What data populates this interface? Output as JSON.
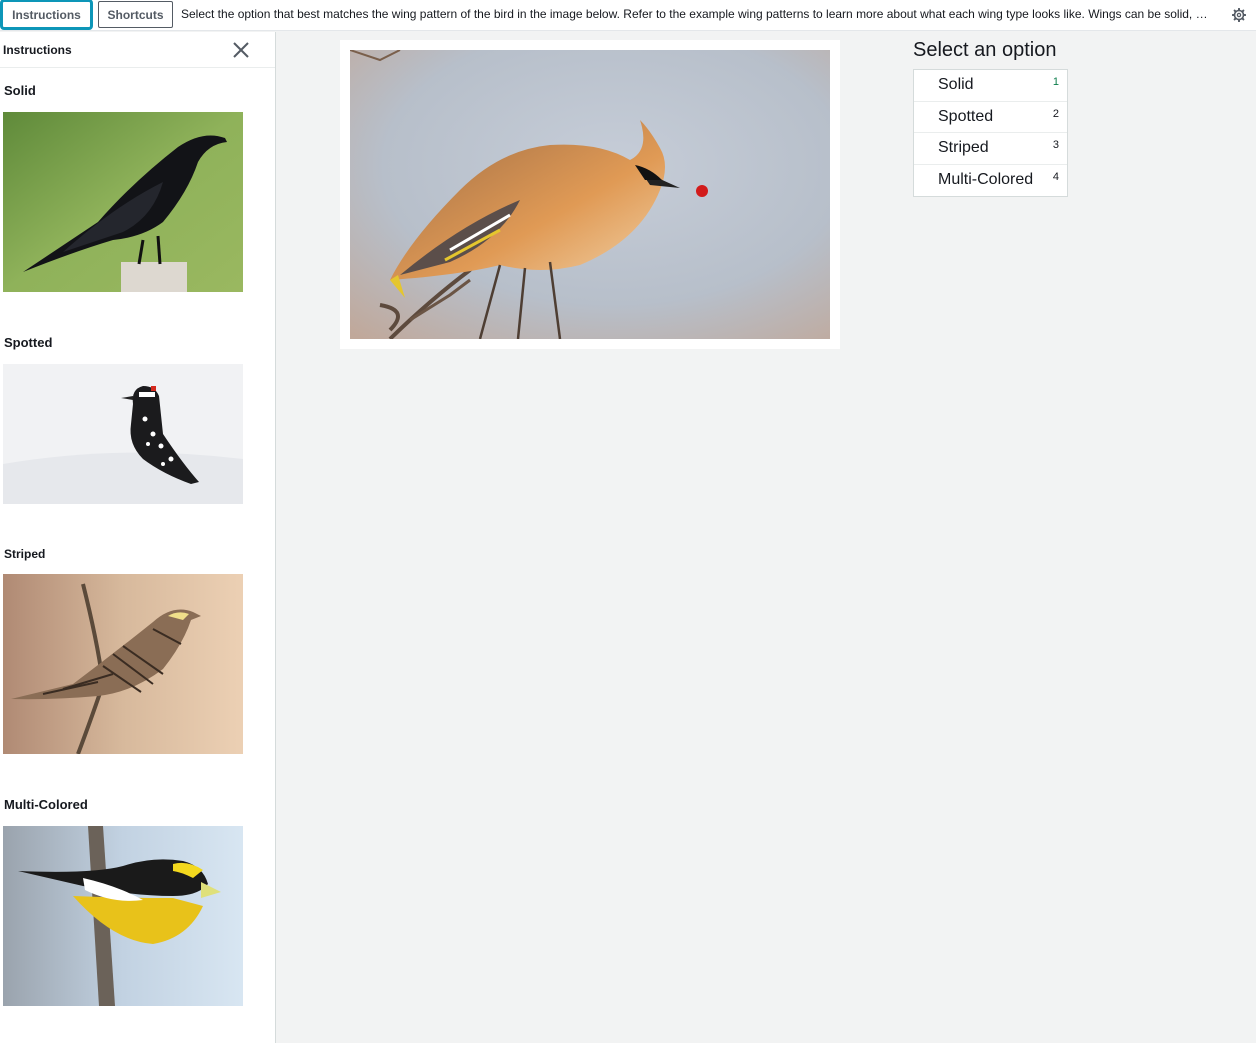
{
  "topbar": {
    "instructions_label": "Instructions",
    "shortcuts_label": "Shortcuts",
    "prompt": "Select the option that best matches the wing pattern of the bird in the image below. Refer to the example wing patterns to learn more about what each wing type looks like. Wings can be solid, …",
    "settings_icon": "gear-icon"
  },
  "panel": {
    "title": "Instructions",
    "close_icon": "close-icon",
    "examples": [
      {
        "label": "Solid",
        "image": "black crow on post"
      },
      {
        "label": "Spotted",
        "image": "black and white spotted woodpecker in snow"
      },
      {
        "label": "Striped",
        "image": "striped brown sparrow on twig"
      },
      {
        "label": "Multi-Colored",
        "image": "yellow, black and white grosbeak on branch"
      }
    ]
  },
  "main": {
    "image": "waxwing catching a red berry"
  },
  "options": {
    "title": "Select an option",
    "items": [
      {
        "label": "Solid",
        "key": "1"
      },
      {
        "label": "Spotted",
        "key": "2"
      },
      {
        "label": "Striped",
        "key": "3"
      },
      {
        "label": "Multi-Colored",
        "key": "4"
      }
    ]
  },
  "colors": {
    "accent": "#0d96b8",
    "background": "#f2f3f3"
  }
}
